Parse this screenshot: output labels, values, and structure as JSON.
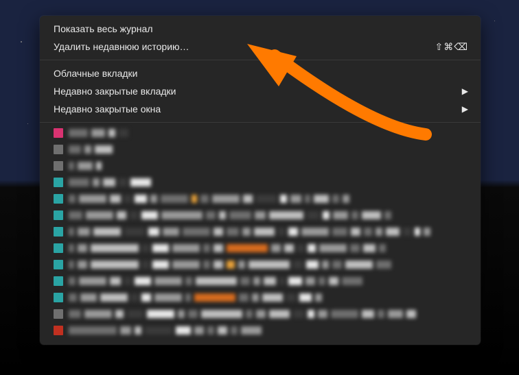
{
  "menu": {
    "top": [
      {
        "label": "Показать весь журнал",
        "shortcut": ""
      },
      {
        "label": "Удалить недавнюю историю…",
        "shortcut": "⇧⌘⌫"
      }
    ],
    "mid": [
      {
        "label": "Облачные вкладки",
        "submenu": false
      },
      {
        "label": "Недавно закрытые вкладки",
        "submenu": true
      },
      {
        "label": "Недавно закрытые окна",
        "submenu": true
      }
    ]
  },
  "colors": {
    "pink": "#d93371",
    "teal": "#2aa4a4",
    "orange_light": "#e8a23a",
    "orange_dark": "#d66b1e",
    "red": "#c13020",
    "grey1": "#6f6f6f",
    "grey2": "#9a9a9a",
    "grey3": "#bfbfbf",
    "dark": "#3a3a3a",
    "white": "#e8e8e8"
  },
  "history_rows": [
    {
      "fav": "pink",
      "segs": [
        28,
        20,
        10,
        14
      ]
    },
    {
      "fav": "grey1",
      "segs": [
        18,
        10,
        26
      ]
    },
    {
      "fav": "grey1",
      "segs": [
        8,
        22,
        8
      ]
    },
    {
      "fav": "teal",
      "segs": [
        30,
        10,
        18,
        12,
        30
      ]
    },
    {
      "fav": "teal",
      "segs": [
        10,
        40,
        16,
        10,
        18,
        10,
        40,
        8,
        12,
        40,
        14,
        30,
        10,
        16,
        8,
        22,
        10,
        10
      ],
      "accent": {
        "i": 7,
        "c": "orange_light"
      }
    },
    {
      "fav": "teal",
      "segs": [
        20,
        40,
        14,
        12,
        24,
        60,
        14,
        10,
        32,
        16,
        50,
        18,
        10,
        22,
        10,
        28,
        10
      ],
      "accent": {
        "i": 11,
        "c": "dark"
      }
    },
    {
      "fav": "teal",
      "segs": [
        8,
        18,
        40,
        30,
        16,
        24,
        40,
        14,
        18,
        12,
        30,
        10,
        14,
        40,
        22,
        14,
        12,
        10,
        20,
        12,
        8,
        10
      ]
    },
    {
      "fav": "teal",
      "segs": [
        8,
        14,
        70,
        10,
        24,
        40,
        10,
        14,
        60,
        14,
        14,
        10,
        12,
        40,
        14,
        18,
        10
      ],
      "accent": {
        "i": 8,
        "c": "orange_dark"
      }
    },
    {
      "fav": "teal",
      "segs": [
        8,
        14,
        70,
        10,
        24,
        40,
        10,
        14,
        12,
        10,
        60,
        14,
        18,
        10,
        14,
        40,
        22
      ],
      "accent": {
        "i": 8,
        "c": "orange_light"
      }
    },
    {
      "fav": "teal",
      "segs": [
        10,
        40,
        16,
        10,
        24,
        40,
        10,
        60,
        14,
        10,
        18,
        8,
        20,
        14,
        10,
        14,
        30
      ]
    },
    {
      "fav": "teal",
      "segs": [
        12,
        24,
        40,
        10,
        14,
        40,
        8,
        60,
        14,
        10,
        30,
        14,
        18,
        10
      ],
      "accent": {
        "i": 7,
        "c": "orange_dark"
      }
    },
    {
      "fav": "grey1",
      "segs": [
        18,
        40,
        12,
        24,
        40,
        10,
        14,
        60,
        10,
        14,
        30,
        16,
        10,
        14,
        40,
        18,
        10,
        22,
        14
      ]
    },
    {
      "fav": "red",
      "segs": [
        70,
        16,
        10,
        40,
        22,
        14,
        10,
        14,
        10,
        30
      ]
    }
  ]
}
